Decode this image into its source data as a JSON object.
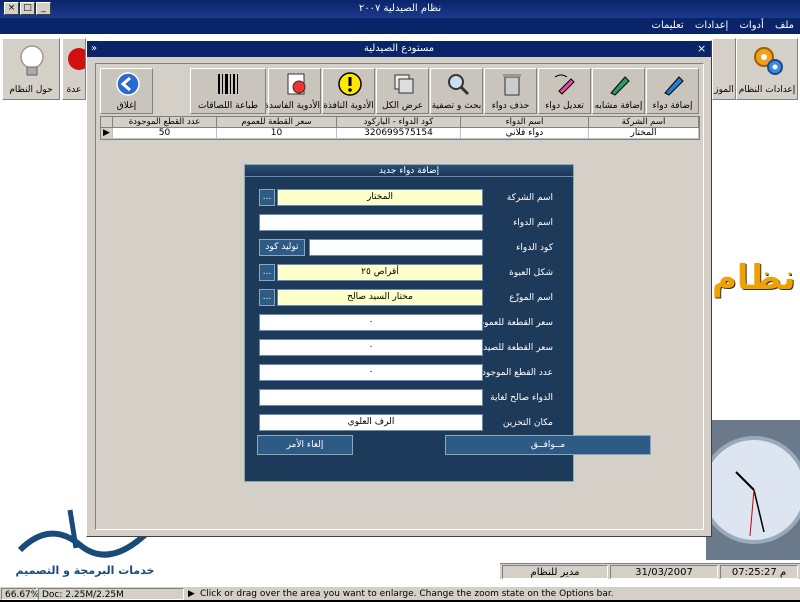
{
  "app": {
    "title": "نظام الصيدلية ٢٠٠٧",
    "menu": [
      "ملف",
      "أدوات",
      "إعدادات",
      "تعليمات"
    ]
  },
  "main": {
    "buttons": [
      {
        "label": "إعدادات النظام",
        "icon": "gears-icon"
      },
      {
        "label": "الموز",
        "icon": "people-icon"
      },
      {
        "label": "حول النظام",
        "icon": "lightbulb-icon"
      },
      {
        "label": "عدة",
        "icon": "stop-icon"
      }
    ],
    "brand_text": "نظام",
    "logo_text": "خدمات البرمجة و التصميم"
  },
  "status": {
    "time": "07:25:27 م",
    "date": "31/03/2007",
    "user": "مدير للنظام"
  },
  "warehouse": {
    "title": "مستودع الصيدلية",
    "toolbar": [
      {
        "label": "إضافة دواء",
        "icon": "pen-icon"
      },
      {
        "label": "إضافة مشابه",
        "icon": "pen-copy-icon"
      },
      {
        "label": "تعديل دواء",
        "icon": "edit-icon"
      },
      {
        "label": "حذف دواء",
        "icon": "trash-icon"
      },
      {
        "label": "بحث و تصفية",
        "icon": "magnifier-icon"
      },
      {
        "label": "عرض الكل",
        "icon": "stack-icon"
      },
      {
        "label": "الأدوية النافذة",
        "icon": "warning-icon"
      },
      {
        "label": "الأدوية الفاسدة",
        "icon": "expired-icon"
      },
      {
        "label": "طباعة اللصاقات",
        "icon": "barcode-icon"
      },
      {
        "label": "إغلاق",
        "icon": "back-arrow-icon"
      }
    ],
    "grid": {
      "columns": [
        "اسم الشركة",
        "اسم الدواء",
        "كود الدواء - الباركود",
        "سعر القطعة للعموم",
        "عدد القطع الموجودة"
      ],
      "rows": [
        [
          "المختار",
          "دواء فلاني",
          "320699575154",
          "10",
          "50"
        ]
      ]
    }
  },
  "dialog": {
    "title": "إضافة دواء جديد",
    "fields": [
      {
        "label": "اسم الشركة",
        "value": "المختار"
      },
      {
        "label": "اسم الدواء",
        "value": ""
      },
      {
        "label": "كود الدواء",
        "value": ""
      },
      {
        "label": "شكل العبوة",
        "value": "أقراص ٢٥"
      },
      {
        "label": "اسم الموزّع",
        "value": "مختار السيد صالح"
      },
      {
        "label": "سعر القطعة للعموم",
        "value": "٠"
      },
      {
        "label": "سعر القطعة للصيدلي",
        "value": "٠"
      },
      {
        "label": "عدد القطع الموجودة",
        "value": "٠"
      },
      {
        "label": "الدواء صالح لغاية",
        "value": ""
      },
      {
        "label": "مكان التخزين",
        "value": "الرف العلوي"
      }
    ],
    "dots": "...",
    "generate_code": "توليد كود",
    "ok": "مــوافــق",
    "cancel": "إلغاء الأمر"
  },
  "taskbar": {
    "zoom": "66.67%",
    "doc": "Doc: 2.25M/2.25M",
    "hint": "Click or drag over the area you want to enlarge. Change the zoom state on the Options bar."
  }
}
